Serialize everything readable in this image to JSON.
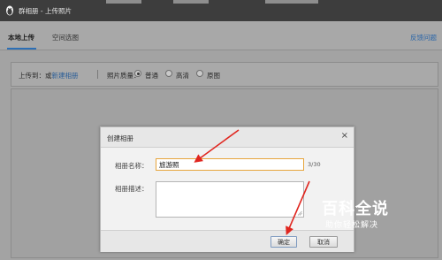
{
  "window": {
    "title": "群相册 - 上传照片"
  },
  "tabs": [
    {
      "label": "本地上传",
      "active": true
    },
    {
      "label": "空间选图",
      "active": false
    }
  ],
  "feedback_link": "反馈问题",
  "upload_bar": {
    "upload_to_label": "上传到：或",
    "new_album_link": "新建相册",
    "separator": "|",
    "quality_label": "照片质量：",
    "quality_options": [
      {
        "label": "普通",
        "selected": true
      },
      {
        "label": "高清",
        "selected": false
      },
      {
        "label": "原图",
        "selected": false
      }
    ]
  },
  "dialog": {
    "title": "创建相册",
    "close_glyph": "×",
    "name_label": "相册名称：",
    "name_value": "旅游照",
    "name_counter": "3/30",
    "desc_label": "相册描述：",
    "desc_value": "",
    "ok_label": "确定",
    "cancel_label": "取消"
  },
  "watermark": {
    "title": "百科全说",
    "subtitle": "助你轻松解决"
  },
  "colors": {
    "titlebar": "#3d3d3d",
    "accent_link": "#2b66a8",
    "input_focus_border": "#e7a53c",
    "annotation_arrow": "#e0261f"
  }
}
